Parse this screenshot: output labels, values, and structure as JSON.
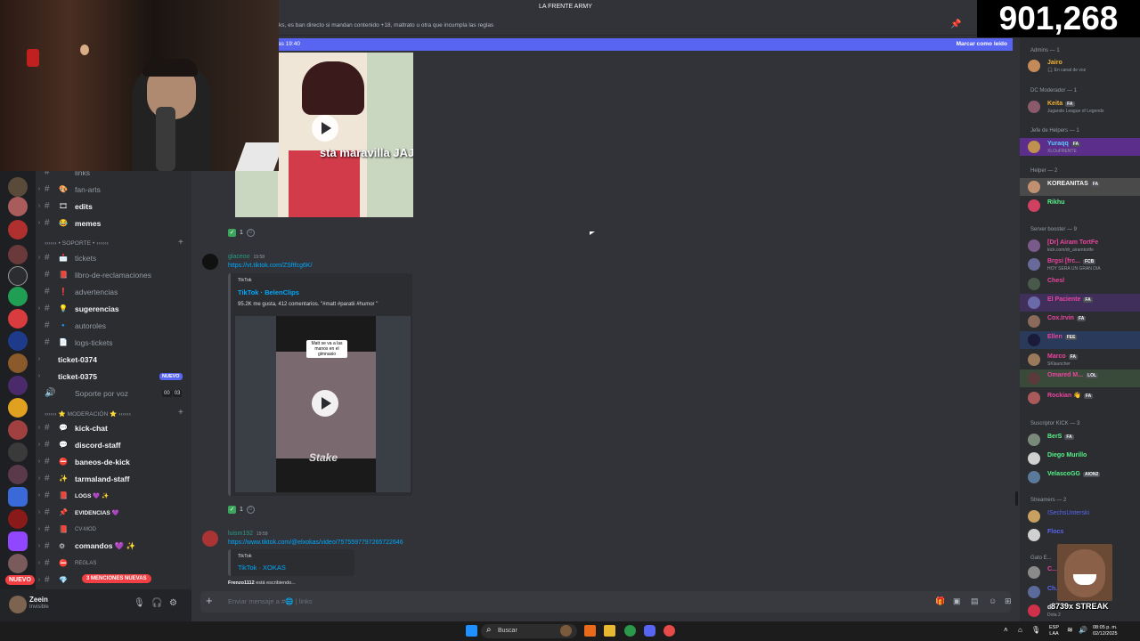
{
  "app": {
    "server_title": "LA FRENTE ARMY"
  },
  "topbar": {
    "topic": "ks, es ban directo si mandan contenido +18, maltrato u otra que incumpla las reglas",
    "new_since": "as 19:40",
    "mark_read": "Marcar como leído"
  },
  "rail": {
    "nuevo_label": "NUEVO"
  },
  "channels": {
    "top_partial": "links",
    "items": [
      {
        "name": "fan-arts",
        "emoji": "🎨",
        "bold": false
      },
      {
        "name": "edits",
        "emoji": "🎞",
        "bold": true
      },
      {
        "name": "memes",
        "emoji": "😂",
        "bold": true
      }
    ],
    "cat_soporte": "›››››› • SOPORTE • ‹‹‹‹‹‹",
    "soporte_items": [
      {
        "name": "tickets",
        "emoji": "📩",
        "bold": false
      },
      {
        "name": "libro-de-reclamaciones",
        "emoji": "📕",
        "bold": false
      },
      {
        "name": "advertencias",
        "emoji": "❗",
        "bold": false
      },
      {
        "name": "sugerencias",
        "emoji": "💡",
        "bold": true
      },
      {
        "name": "autoroles",
        "emoji": "🔹",
        "bold": false
      },
      {
        "name": "logs-tickets",
        "emoji": "📄",
        "bold": false
      }
    ],
    "ticket_a": "ticket-0374",
    "ticket_b": "ticket-0375",
    "nuevo_tag": "NUEVO",
    "voice": "Soporte por voz",
    "voice_count_a": "00",
    "voice_count_b": "03",
    "cat_moderacion": "›››››› ⭐ MODERACIÓN ⭐ ‹‹‹‹‹‹",
    "mod_items": [
      {
        "name": "kick-chat",
        "emoji": "💬",
        "bold": true
      },
      {
        "name": "discord-staff",
        "emoji": "💬",
        "bold": true
      },
      {
        "name": "baneos-de-kick",
        "emoji": "⛔",
        "bold": true
      },
      {
        "name": "tarmaland-staff",
        "emoji": "✨",
        "bold": true
      },
      {
        "name": "LOGS 💜 ✨",
        "emoji": "📕",
        "bold": true
      },
      {
        "name": "EVIDENCIAS 💜",
        "emoji": "📌",
        "bold": true
      },
      {
        "name": "CV-MOD",
        "emoji": "📕",
        "bold": false
      },
      {
        "name": "comandos 💜 ✨",
        "emoji": "⚙",
        "bold": true
      },
      {
        "name": "REGLAS",
        "emoji": "⛔",
        "bold": false
      },
      {
        "name": "",
        "emoji": "💎",
        "bold": false
      }
    ],
    "mentions_pill": "3 MENCIONES NUEVAS"
  },
  "user": {
    "name": "Zeein",
    "status": "Invisible"
  },
  "messages": {
    "video1_caption": "sta maravilla JAJAJA",
    "reaction1_count": "1",
    "msg2": {
      "user": "glaceoo",
      "time": "19:58",
      "link": "https://vt.tiktok.com/ZSftfcg6K/",
      "provider": "TikTok",
      "title": "TikTok · BelenClips",
      "desc": "95.2K me gusta, 412 comentarios. \"#matt #paratii #humor \"",
      "video_caption": "Matt se va a las manos en el gimnasio",
      "video_brand": "Stake",
      "reaction_count": "1"
    },
    "msg3": {
      "user": "luism192",
      "time": "19:59",
      "link": "https://www.tiktok.com/@elxokas/video/7575597797265722646",
      "provider": "TikTok",
      "title": "TikTok · XOKAS"
    },
    "typing_user": "Frenzo1112",
    "typing_text": "está escribiendo...",
    "composer_placeholder": "Enviar mensaje a #🌐 | links"
  },
  "members": {
    "groups": [
      {
        "header": "Admins — 1",
        "members": [
          {
            "name": "Jairo",
            "sub": "🎧 En canal de voz",
            "color": "#f0b232"
          }
        ]
      },
      {
        "header": "DC Moderador — 1",
        "members": [
          {
            "name": "Keita",
            "tag": "FA",
            "sub": "Jugando League of Legends",
            "color": "#f0b232"
          }
        ]
      },
      {
        "header": "Jefe de Helpers — 1",
        "members": [
          {
            "name": "Yuraqq",
            "tag": "FA",
            "sub": "XLOuFRENTE",
            "color": "#5ec8ff"
          }
        ]
      },
      {
        "header": "Helper — 2",
        "members": [
          {
            "name": "KOREANITAS",
            "tag": "FA",
            "color": "#f2f3f5"
          },
          {
            "name": "Rikhu",
            "color": "#57f287"
          }
        ]
      },
      {
        "header": "Server booster — 9",
        "members": [
          {
            "name": "[Dr] Airam TortFe",
            "sub": "kick.com/dr_airamtortfe",
            "color": "#eb459f"
          },
          {
            "name": "Brgsi [frc...",
            "tag": "FCB",
            "sub": "HOY SERA UN GRAN DIA",
            "color": "#eb459f"
          },
          {
            "name": "Chesl",
            "color": "#eb459f"
          },
          {
            "name": "El Paciente",
            "tag": "FA",
            "color": "#eb459f"
          },
          {
            "name": "Cox.Irvin",
            "tag": "FA",
            "color": "#eb459f"
          },
          {
            "name": "Ellen",
            "tag": "FEE",
            "color": "#eb459f"
          },
          {
            "name": "Marco",
            "tag": "FA",
            "sub": "SKlauncher",
            "color": "#eb459f"
          },
          {
            "name": "Omared M...",
            "tag": "LOL",
            "color": "#eb459f"
          },
          {
            "name": "Rockian 👋",
            "tag": "FA",
            "color": "#eb459f"
          }
        ]
      },
      {
        "header": "Suscriptor KICK — 3",
        "members": [
          {
            "name": "BerS",
            "tag": "FA",
            "color": "#57f287"
          },
          {
            "name": "Diego Murillo",
            "color": "#57f287"
          },
          {
            "name": "VelascoGG",
            "tag": "AION2",
            "color": "#57f287"
          }
        ]
      },
      {
        "header": "Streamers — 2",
        "members": [
          {
            "name": "ISechsUnterski",
            "color": "#5865f2"
          },
          {
            "name": "Flocs",
            "color": "#5865f2"
          }
        ]
      },
      {
        "header": "Gato E...",
        "members": [
          {
            "name": "C...",
            "color": "#eb459f"
          },
          {
            "name": "Ch...",
            "color": "#5865f2"
          },
          {
            "name": "d...",
            "sub": "Dota 2",
            "color": "#f2f3f5"
          }
        ]
      }
    ]
  },
  "overlay": {
    "counter": "901,268",
    "streak": "8739x STREAK"
  },
  "taskbar": {
    "search": "Buscar",
    "lang_a": "ESP",
    "lang_b": "LAA",
    "time": "08:05 p. m.",
    "date": "02/12/2025"
  },
  "colors": {
    "accent": "#5865f2",
    "link": "#00a8fc",
    "background": "#313338",
    "sidebar": "#2b2d31"
  }
}
